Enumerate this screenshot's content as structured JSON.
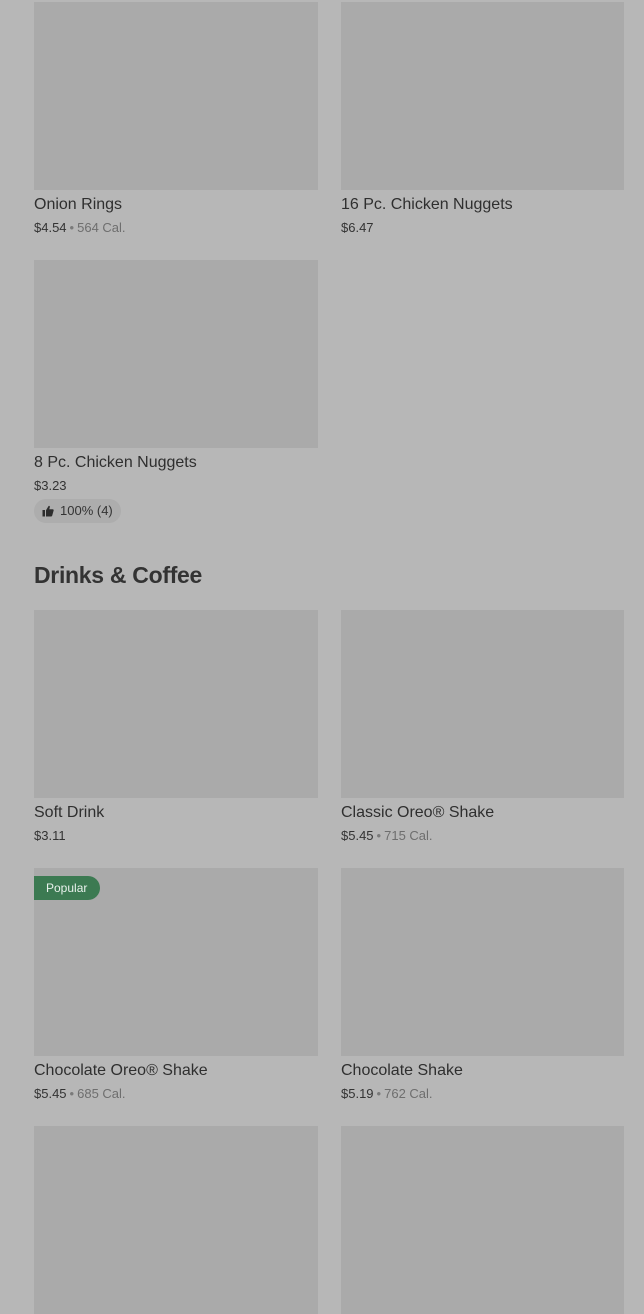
{
  "items_top": [
    {
      "name": "Onion Rings",
      "price": "$4.54",
      "calories": "564 Cal."
    },
    {
      "name": "16 Pc. Chicken Nuggets",
      "price": "$6.47"
    },
    {
      "name": "8 Pc. Chicken Nuggets",
      "price": "$3.23",
      "rating": "100% (4)"
    }
  ],
  "section": {
    "title": "Drinks & Coffee"
  },
  "drinks": [
    {
      "name": "Soft Drink",
      "price": "$3.11"
    },
    {
      "name": "Classic Oreo® Shake",
      "price": "$5.45",
      "calories": "715 Cal."
    },
    {
      "name": "Chocolate Oreo® Shake",
      "price": "$5.45",
      "calories": "685 Cal.",
      "badge": "Popular"
    },
    {
      "name": "Chocolate Shake",
      "price": "$5.19",
      "calories": "762 Cal."
    }
  ],
  "separator": "•",
  "icons": {
    "rating": "thumbs-up-icon"
  },
  "colors": {
    "popular_badge": "#3c7a52",
    "background_overlay": "#b7b7b7",
    "thumbnail": "#aaaaaa"
  }
}
